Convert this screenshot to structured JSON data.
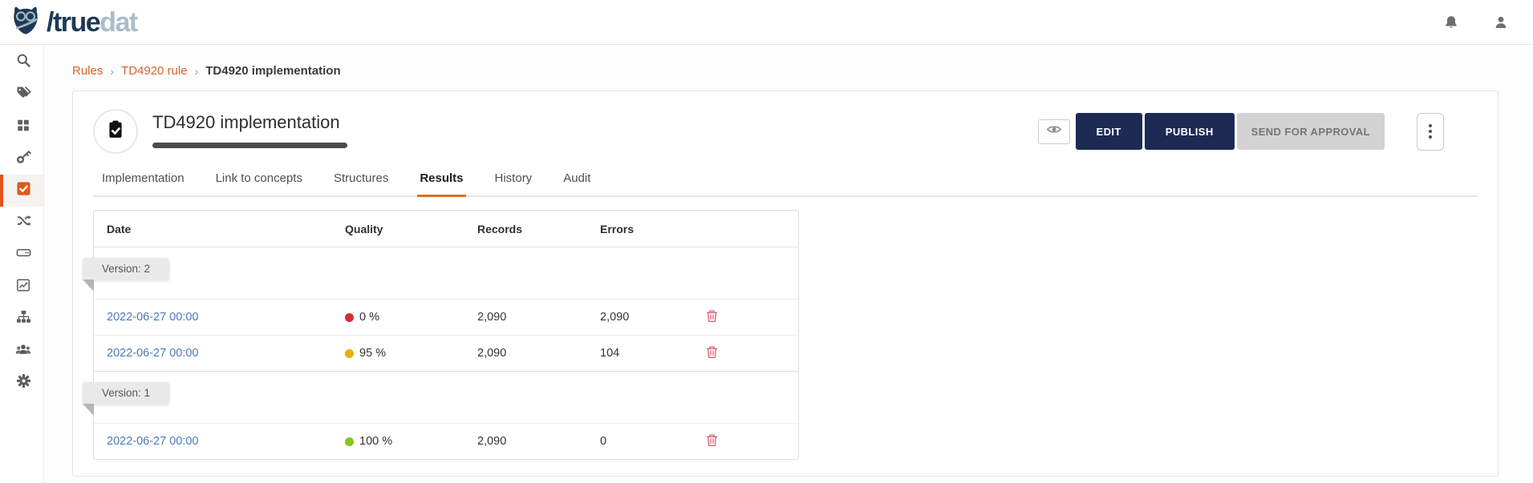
{
  "brand": {
    "logo_primary": "/true",
    "logo_secondary": "dat"
  },
  "topbar": {
    "icons": [
      "bell-icon",
      "user-icon"
    ]
  },
  "sidebar": {
    "active_index": 4,
    "items": [
      {
        "icon": "search-icon"
      },
      {
        "icon": "tags-icon"
      },
      {
        "icon": "grid-icon"
      },
      {
        "icon": "key-icon"
      },
      {
        "icon": "check-square-icon"
      },
      {
        "icon": "shuffle-icon"
      },
      {
        "icon": "drive-icon"
      },
      {
        "icon": "chart-line-icon"
      },
      {
        "icon": "sitemap-icon"
      },
      {
        "icon": "users-icon"
      },
      {
        "icon": "gear-icon"
      }
    ]
  },
  "breadcrumb": {
    "separator": "›",
    "links": [
      "Rules",
      "TD4920 rule"
    ],
    "current": "TD4920 implementation"
  },
  "page": {
    "title": "TD4920 implementation",
    "actions": {
      "edit": "EDIT",
      "publish": "PUBLISH",
      "send_for_approval": "SEND FOR APPROVAL"
    },
    "tabs": [
      {
        "label": "Implementation",
        "active": false
      },
      {
        "label": "Link to concepts",
        "active": false
      },
      {
        "label": "Structures",
        "active": false
      },
      {
        "label": "Results",
        "active": true
      },
      {
        "label": "History",
        "active": false
      },
      {
        "label": "Audit",
        "active": false
      }
    ]
  },
  "results_table": {
    "columns": [
      "Date",
      "Quality",
      "Records",
      "Errors"
    ],
    "groups": [
      {
        "version_label": "Version: 2",
        "rows": [
          {
            "date": "2022-06-27 00:00",
            "quality": "0 %",
            "quality_color": "#d42f38",
            "records": "2,090",
            "errors": "2,090"
          },
          {
            "date": "2022-06-27 00:00",
            "quality": "95 %",
            "quality_color": "#eead0c",
            "records": "2,090",
            "errors": "104"
          }
        ]
      },
      {
        "version_label": "Version: 1",
        "rows": [
          {
            "date": "2022-06-27 00:00",
            "quality": "100 %",
            "quality_color": "#84c61c",
            "records": "2,090",
            "errors": "0"
          }
        ]
      }
    ]
  },
  "colors": {
    "accent": "#e0701c",
    "navy": "#1c2a54",
    "link_blue": "#4d79bb"
  }
}
